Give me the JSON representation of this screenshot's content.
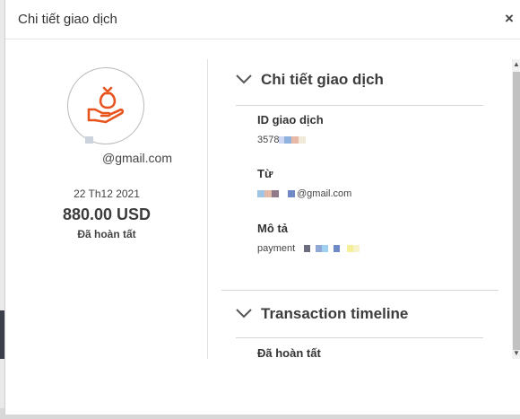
{
  "modal": {
    "title": "Chi tiết giao dịch",
    "close_label": "×"
  },
  "summary": {
    "email": "@gmail.com",
    "date": "22 Th12 2021",
    "amount": "880.00 USD",
    "status": "Đã hoàn tất"
  },
  "details": {
    "section_title": "Chi tiết giao dịch",
    "fields": [
      {
        "label": "ID giao dịch",
        "value": "3578"
      },
      {
        "label": "Từ",
        "value": "@gmail.com"
      },
      {
        "label": "Mô tả",
        "value": "payment"
      }
    ]
  },
  "timeline": {
    "section_title": "Transaction timeline",
    "first_status": "Đã hoàn tất"
  },
  "icons": {
    "money_hand": "money-hand-icon",
    "chevron": "chevron-down-icon",
    "close": "close-icon"
  },
  "colors": {
    "accent": "#e8541e",
    "text": "#3d3d3d"
  }
}
